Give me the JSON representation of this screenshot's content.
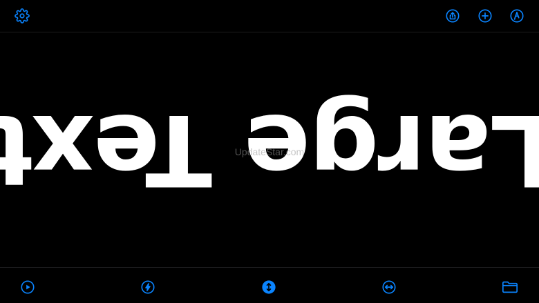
{
  "display": {
    "text": "Large Text",
    "orientation": "rotated-180"
  },
  "watermark": "UpdateStar.com",
  "toolbar_top": {
    "left": [
      "gear-icon"
    ],
    "right": [
      "share-icon",
      "plus-icon",
      "pen-icon"
    ]
  },
  "toolbar_bottom": [
    "play-icon",
    "lightning-icon",
    "vertical-scroll-icon",
    "horizontal-scroll-icon",
    "folder-icon"
  ],
  "colors": {
    "accent": "#0a84ff",
    "background": "#000000",
    "text": "#ffffff"
  }
}
